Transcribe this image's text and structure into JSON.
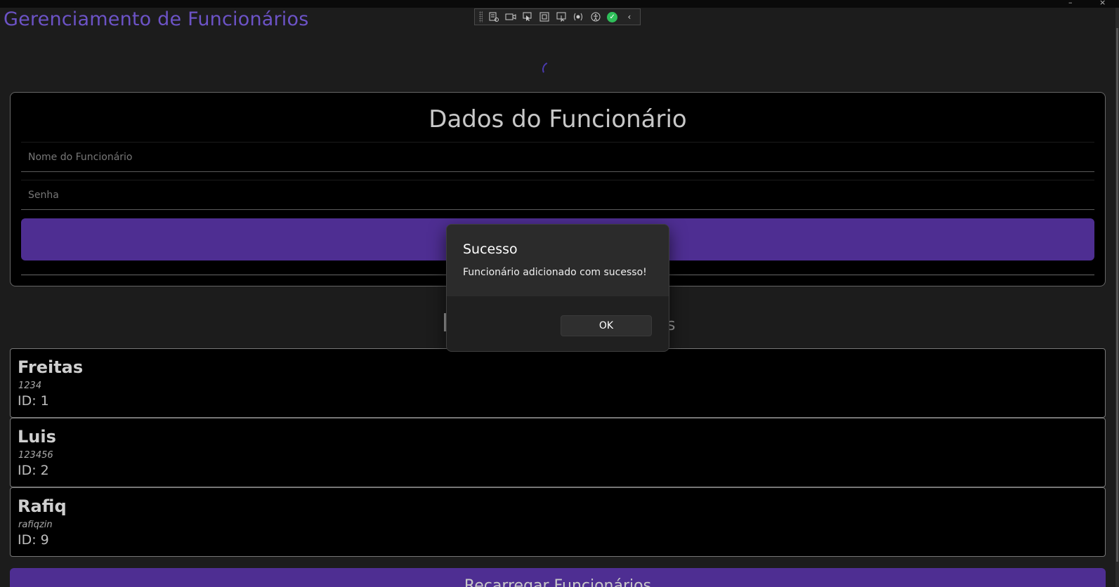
{
  "app": {
    "title": "Gerenciamento de Funcionários"
  },
  "window_controls": [
    "–",
    "×"
  ],
  "devtools_toolbar": {
    "tools": [
      "live-visual-tree-icon",
      "record-icon",
      "select-element-icon",
      "display-layout-adorners-icon",
      "track-focus-icon",
      "binding-failures-icon",
      "accessibility-icon",
      "check-icon",
      "collapse-chevron-icon"
    ]
  },
  "form": {
    "heading": "Dados do Funcionário",
    "name_placeholder": "Nome do Funcionário",
    "password_placeholder": "Senha",
    "accent_color": "#4e2e92"
  },
  "list_heading_fragment_right": "s",
  "employees": [
    {
      "name": "Freitas",
      "password": "1234",
      "id_label": "ID: 1"
    },
    {
      "name": "Luis",
      "password": "123456",
      "id_label": "ID: 2"
    },
    {
      "name": "Rafiq",
      "password": "rafiqzin",
      "id_label": "ID: 9"
    }
  ],
  "reload_button": {
    "label": "Recarregar Funcionários"
  },
  "dialog": {
    "title": "Sucesso",
    "message": "Funcionário adicionado com sucesso!",
    "ok_label": "OK"
  }
}
